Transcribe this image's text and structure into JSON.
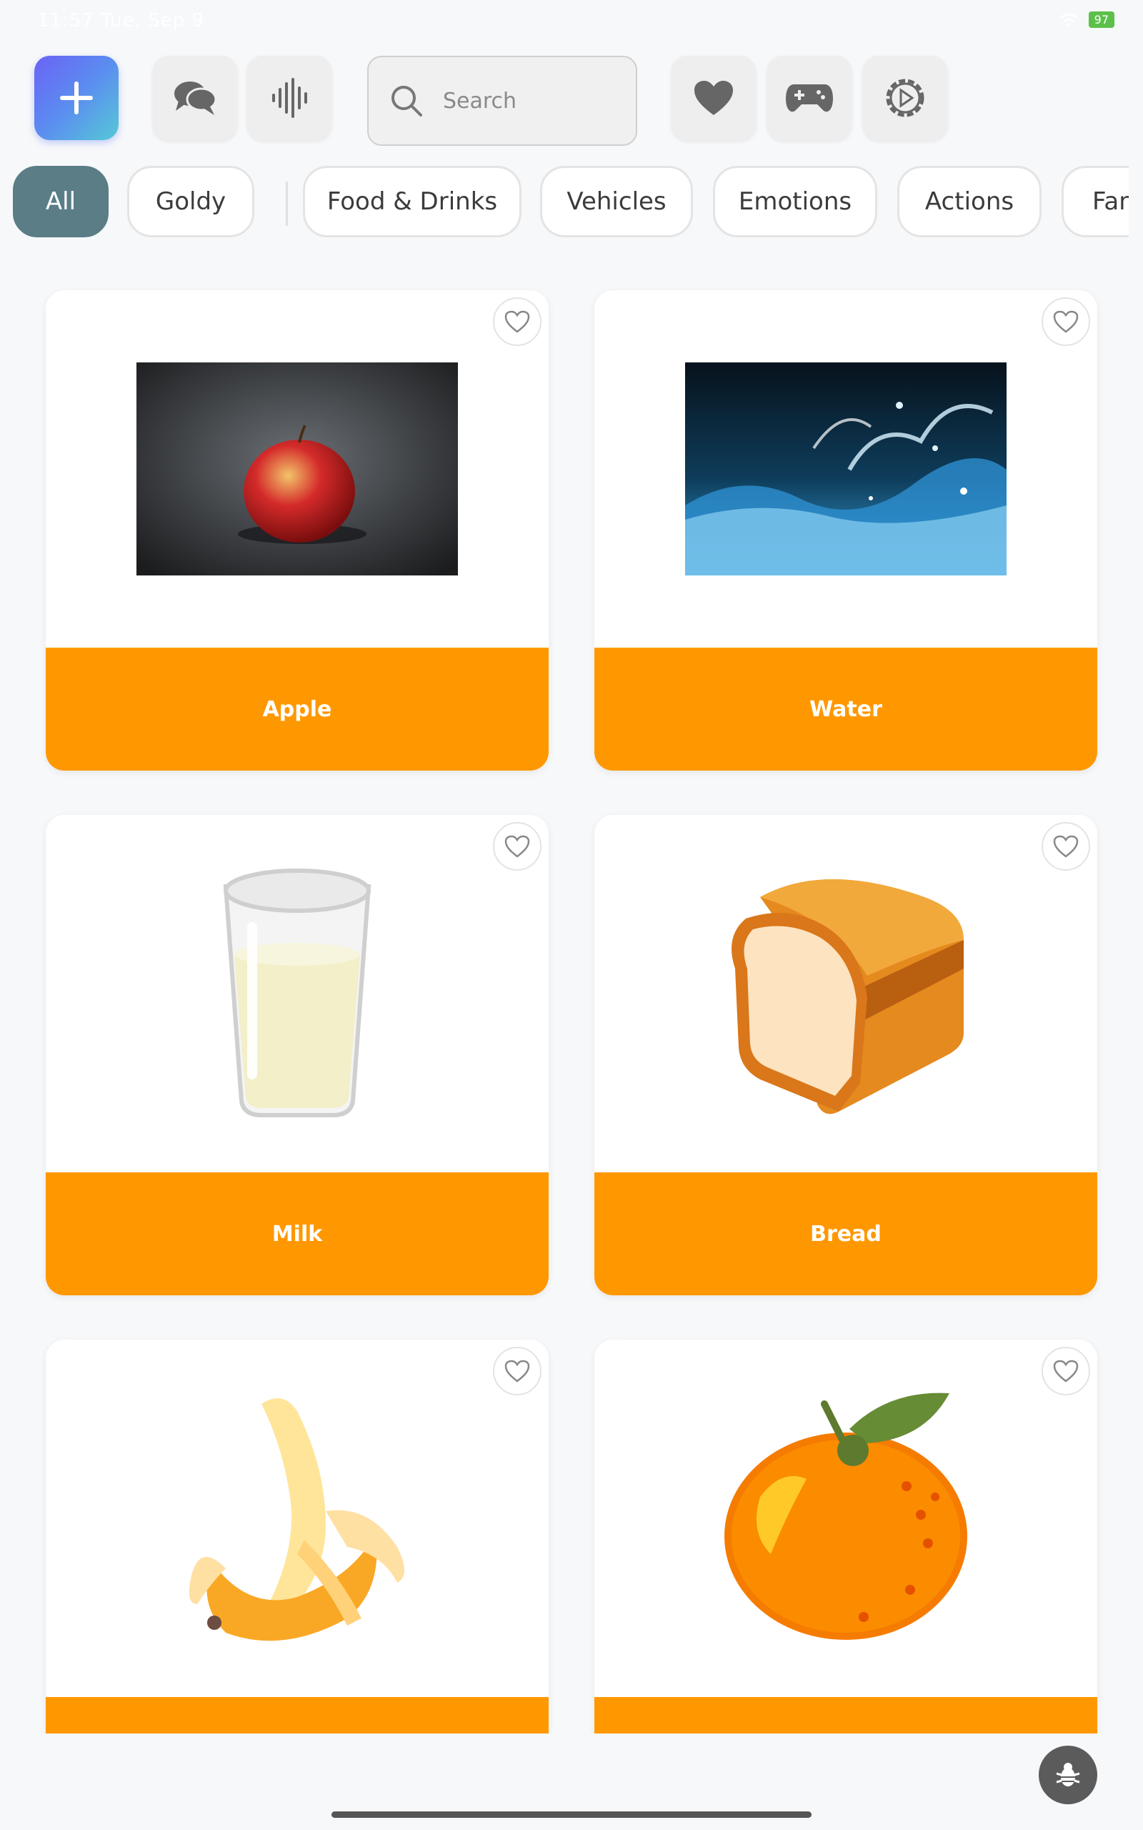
{
  "status_bar": {
    "time": "11:57  Tue, Sep 9",
    "battery": "97"
  },
  "toolbar": {
    "search_placeholder": "Search",
    "buttons": [
      "plus-icon",
      "chat-icon",
      "soundwave-icon",
      "heart-icon",
      "gamepad-icon",
      "settings-icon"
    ]
  },
  "categories": [
    {
      "label": "All",
      "active": true
    },
    {
      "label": "Goldy",
      "active": false
    },
    {
      "label": "Food & Drinks",
      "active": false
    },
    {
      "label": "Vehicles",
      "active": false
    },
    {
      "label": "Emotions",
      "active": false
    },
    {
      "label": "Actions",
      "active": false
    },
    {
      "label": "Fan",
      "active": false
    }
  ],
  "cards": [
    {
      "label": "Apple",
      "image": "apple-photo"
    },
    {
      "label": "Water",
      "image": "water-photo"
    },
    {
      "label": "Milk",
      "image": "milk-glass-icon"
    },
    {
      "label": "Bread",
      "image": "bread-loaf-icon"
    },
    {
      "label": "",
      "image": "banana-icon"
    },
    {
      "label": "",
      "image": "tangerine-icon"
    }
  ],
  "colors": {
    "accent": "#ff9800",
    "active_chip": "#5a7d86",
    "background": "#f7f8fa"
  }
}
